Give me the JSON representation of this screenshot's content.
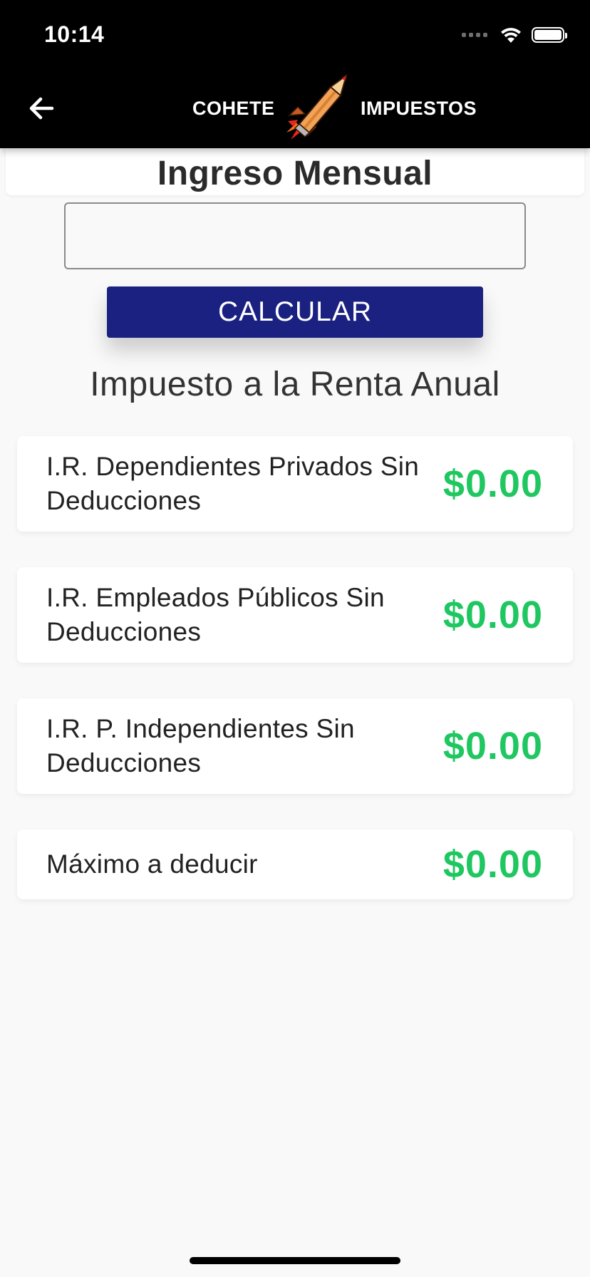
{
  "status_bar": {
    "time": "10:14"
  },
  "app_bar": {
    "title_left": "COHETE",
    "title_right": "IMPUESTOS",
    "back_icon": "arrow-left-icon",
    "logo_icon": "rocket-pencil-icon"
  },
  "form": {
    "heading": "Ingreso Mensual",
    "income_value": "",
    "income_placeholder": "",
    "calculate_label": "CALCULAR"
  },
  "results": {
    "title": "Impuesto a la Renta Anual",
    "items": [
      {
        "label": "I.R. Dependientes Privados Sin Deducciones",
        "value": "$0.00"
      },
      {
        "label": "I.R. Empleados Públicos Sin Deducciones",
        "value": "$0.00"
      },
      {
        "label": "I.R. P. Independientes Sin Deducciones",
        "value": "$0.00"
      },
      {
        "label": "Máximo a deducir",
        "value": "$0.00"
      }
    ]
  },
  "colors": {
    "app_bar": "#000000",
    "button": "#1b2180",
    "value": "#1fc760",
    "background": "#f9f9f9"
  }
}
